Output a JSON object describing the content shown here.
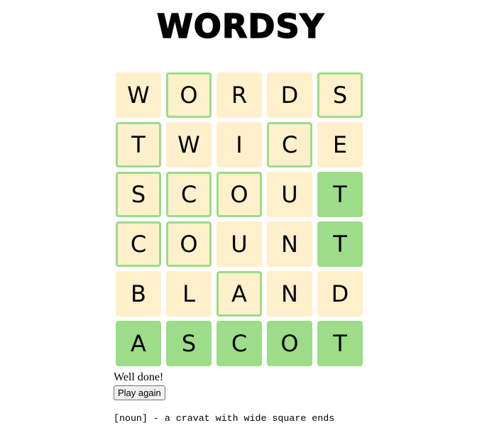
{
  "app": {
    "title": "WORDSY"
  },
  "board": {
    "rows": [
      [
        {
          "letter": "W",
          "state": "absent"
        },
        {
          "letter": "O",
          "state": "present"
        },
        {
          "letter": "R",
          "state": "absent"
        },
        {
          "letter": "D",
          "state": "absent"
        },
        {
          "letter": "S",
          "state": "present"
        }
      ],
      [
        {
          "letter": "T",
          "state": "present"
        },
        {
          "letter": "W",
          "state": "absent"
        },
        {
          "letter": "I",
          "state": "absent"
        },
        {
          "letter": "C",
          "state": "present"
        },
        {
          "letter": "E",
          "state": "absent"
        }
      ],
      [
        {
          "letter": "S",
          "state": "present"
        },
        {
          "letter": "C",
          "state": "present"
        },
        {
          "letter": "O",
          "state": "present"
        },
        {
          "letter": "U",
          "state": "absent"
        },
        {
          "letter": "T",
          "state": "correct"
        }
      ],
      [
        {
          "letter": "C",
          "state": "present"
        },
        {
          "letter": "O",
          "state": "present"
        },
        {
          "letter": "U",
          "state": "absent"
        },
        {
          "letter": "N",
          "state": "absent"
        },
        {
          "letter": "T",
          "state": "correct"
        }
      ],
      [
        {
          "letter": "B",
          "state": "absent"
        },
        {
          "letter": "L",
          "state": "absent"
        },
        {
          "letter": "A",
          "state": "present"
        },
        {
          "letter": "N",
          "state": "absent"
        },
        {
          "letter": "D",
          "state": "absent"
        }
      ],
      [
        {
          "letter": "A",
          "state": "correct"
        },
        {
          "letter": "S",
          "state": "correct"
        },
        {
          "letter": "C",
          "state": "correct"
        },
        {
          "letter": "O",
          "state": "correct"
        },
        {
          "letter": "T",
          "state": "correct"
        }
      ]
    ]
  },
  "result": {
    "message": "Well done!",
    "play_again_label": "Play again",
    "definition": "[noun] - a cravat with wide square ends"
  },
  "colors": {
    "absent_bg": "#fff0cc",
    "present_border": "#9ddc88",
    "correct_bg": "#9ddc88"
  }
}
